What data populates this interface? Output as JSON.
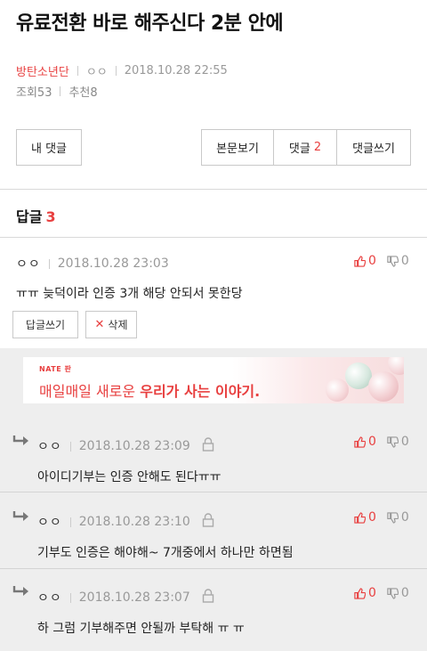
{
  "post": {
    "title": "유료전환 바로 해주신다 2분 안에",
    "author": "방탄소년단",
    "nickname": "ㅇㅇ",
    "datetime": "2018.10.28 22:55",
    "views_label": "조회53",
    "recommend_label": "추천8"
  },
  "buttons": {
    "my_comments": "내 댓글",
    "view_body": "본문보기",
    "comments_label": "댓글",
    "comments_count": "2",
    "write_comment": "댓글쓰기"
  },
  "replies": {
    "label": "답글",
    "count": "3"
  },
  "comments": [
    {
      "nickname": "ㅇㅇ",
      "datetime": "2018.10.28 23:03",
      "text": "ㅠㅠ 늦덕이라 인증 3개 해당 안되서 못한당",
      "up": "0",
      "down": "0",
      "reply_btn": "답글쓰기",
      "delete_btn": "삭제"
    }
  ],
  "ad": {
    "brand": "NATE 판",
    "copy_normal": "매일매일 새로운",
    "copy_bold": "우리가 사는 이야기."
  },
  "sub_comments": [
    {
      "nickname": "ㅇㅇ",
      "datetime": "2018.10.28 23:09",
      "text": "아이디기부는 인증 안해도 된다ㅠㅠ",
      "up": "0",
      "down": "0"
    },
    {
      "nickname": "ㅇㅇ",
      "datetime": "2018.10.28 23:10",
      "text": "기부도 인증은 해야해~ 7개중에서 하나만 하면됨",
      "up": "0",
      "down": "0"
    },
    {
      "nickname": "ㅇㅇ",
      "datetime": "2018.10.28 23:07",
      "text": "하 그럼 기부해주면 안될까 부탁해 ㅠ ㅠ",
      "up": "0",
      "down": "0"
    }
  ],
  "colors": {
    "accent": "#e83f3f",
    "muted": "#999999",
    "border": "#c9c9c9",
    "bar": "#eeeeee"
  }
}
